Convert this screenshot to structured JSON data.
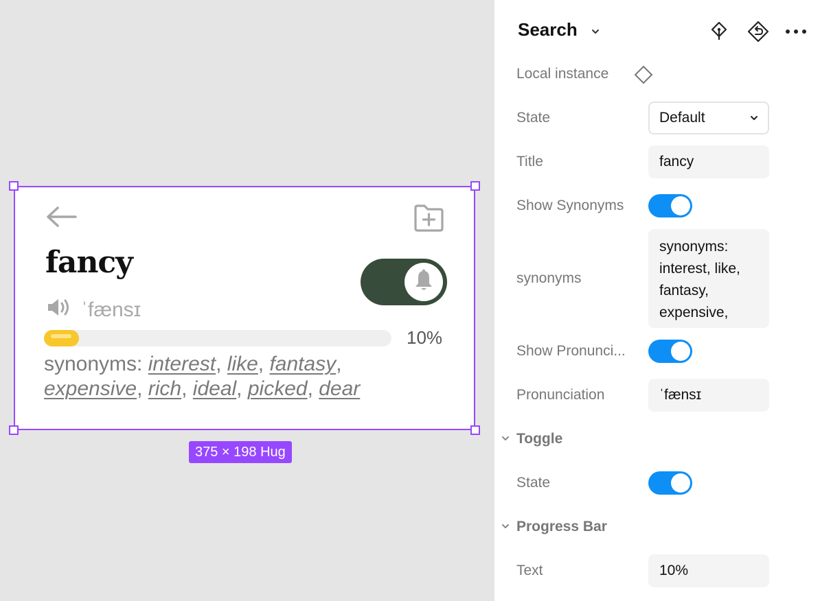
{
  "canvas": {
    "frame_size_label": "375 × 198 Hug",
    "card": {
      "title": "fancy",
      "pronunciation": "ˈfænsɪ",
      "progress_text": "10%",
      "progress_value": 0.1,
      "synonyms_prefix": "synonyms: ",
      "synonyms": [
        "interest",
        "like",
        "fantasy",
        "expensive",
        "rich",
        "ideal",
        "picked",
        "dear"
      ],
      "icons": [
        "back-arrow-icon",
        "folder-add-icon",
        "speaker-icon",
        "bell-icon"
      ],
      "toggle_color": "#374c3a",
      "progress_color": "#f7c72c"
    }
  },
  "panel": {
    "title": "Search",
    "icons": [
      "chevron-down-icon",
      "go-to-main-component-icon",
      "reset-instance-icon",
      "more-options-icon",
      "component-diamond-icon"
    ],
    "local_instance_label": "Local instance",
    "state_label": "State",
    "state_value": "Default",
    "title_label": "Title",
    "title_value": "fancy",
    "show_synonyms_label": "Show Synonyms",
    "synonyms_label": "synonyms",
    "synonyms_value_lines": [
      "synonyms:",
      "interest, like,",
      "fantasy,",
      "expensive,"
    ],
    "show_pronunciation_label": "Show Pronunci...",
    "pronunciation_label": "Pronunciation",
    "pronunciation_value": "ˈfænsɪ",
    "toggle_section": "Toggle",
    "toggle_state_label": "State",
    "progress_section": "Progress Bar",
    "text_label": "Text",
    "text_value": "10%",
    "switch_color": "#0d8ff6",
    "selection_color": "#9747ff"
  }
}
